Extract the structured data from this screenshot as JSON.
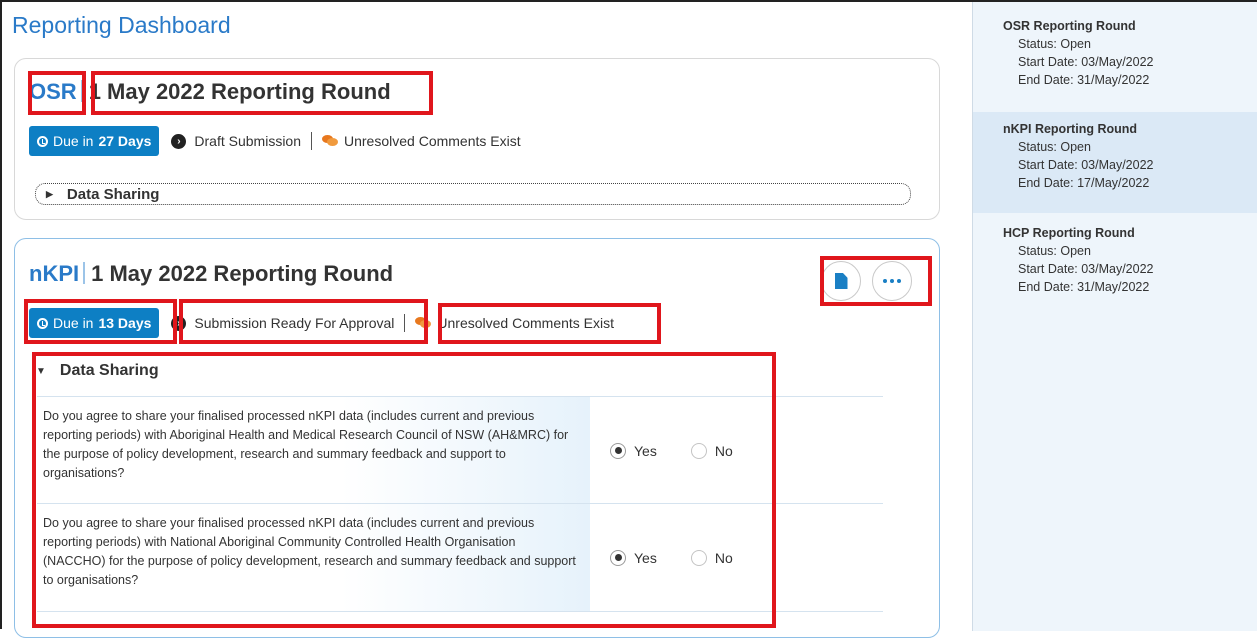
{
  "page": {
    "title": "Reporting Dashboard"
  },
  "rounds_main": [
    {
      "abbr": "OSR",
      "name": "1 May 2022 Reporting Round",
      "due_prefix": "Due in ",
      "due_days": "27 Days",
      "status": "Draft Submission",
      "comments": "Unresolved Comments Exist",
      "data_sharing_label": "Data Sharing"
    },
    {
      "abbr": "nKPI",
      "name": "1 May 2022 Reporting Round",
      "due_prefix": "Due in ",
      "due_days": "13 Days",
      "status": "Submission Ready For Approval",
      "comments": "Unresolved Comments Exist",
      "data_sharing_label": "Data Sharing",
      "questions": [
        {
          "text": "Do you agree to share your finalised processed nKPI data (includes current and previous reporting periods) with Aboriginal Health and Medical Research Council of NSW (AH&MRC) for the purpose of policy development, research and summary feedback and support to organisations?",
          "yes": "Yes",
          "no": "No",
          "selected": "Yes"
        },
        {
          "text": "Do you agree to share your finalised processed nKPI data (includes current and previous reporting periods) with National Aboriginal Community Controlled Health Organisation (NACCHO) for the purpose of policy development, research and summary feedback and support to organisations?",
          "yes": "Yes",
          "no": "No",
          "selected": "Yes"
        }
      ]
    }
  ],
  "sidebar": {
    "rounds": [
      {
        "title": "OSR Reporting Round",
        "status": "Status: Open",
        "start": "Start Date: 03/May/2022",
        "end": "End Date: 31/May/2022"
      },
      {
        "title": "nKPI Reporting Round",
        "status": "Status: Open",
        "start": "Start Date: 03/May/2022",
        "end": "End Date: 17/May/2022"
      },
      {
        "title": "HCP Reporting Round",
        "status": "Status: Open",
        "start": "Start Date: 03/May/2022",
        "end": "End Date: 31/May/2022"
      }
    ]
  },
  "icons": [
    "clock-icon",
    "chevron-right-circle-icon",
    "comments-icon",
    "caret-right-icon",
    "caret-down-icon",
    "document-icon",
    "ellipsis-icon"
  ],
  "colors": {
    "accent": "#0d7fc4",
    "title": "#2a7ac8",
    "highlight": "#e0161c",
    "comments": "#e8781e",
    "sidebar_bg": "#eef5fb"
  }
}
